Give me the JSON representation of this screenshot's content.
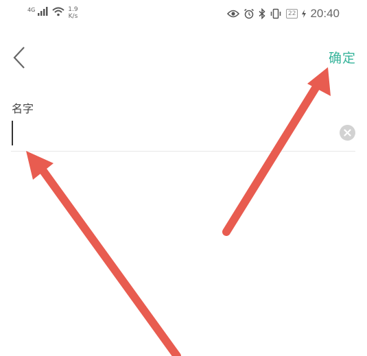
{
  "status_bar": {
    "network": "4G",
    "speed_value": "1.9",
    "speed_unit": "K/s",
    "battery": "22",
    "time": "20:40"
  },
  "header": {
    "confirm_label": "确定"
  },
  "form": {
    "name_label": "名字",
    "name_value": ""
  },
  "icons": [
    "back-chevron-icon",
    "clear-icon",
    "eye-icon",
    "alarm-icon",
    "bluetooth-icon",
    "vibrate-icon",
    "wifi-icon",
    "signal-icon"
  ],
  "colors": {
    "accent": "#35b39a",
    "arrow": "#e85c50"
  }
}
